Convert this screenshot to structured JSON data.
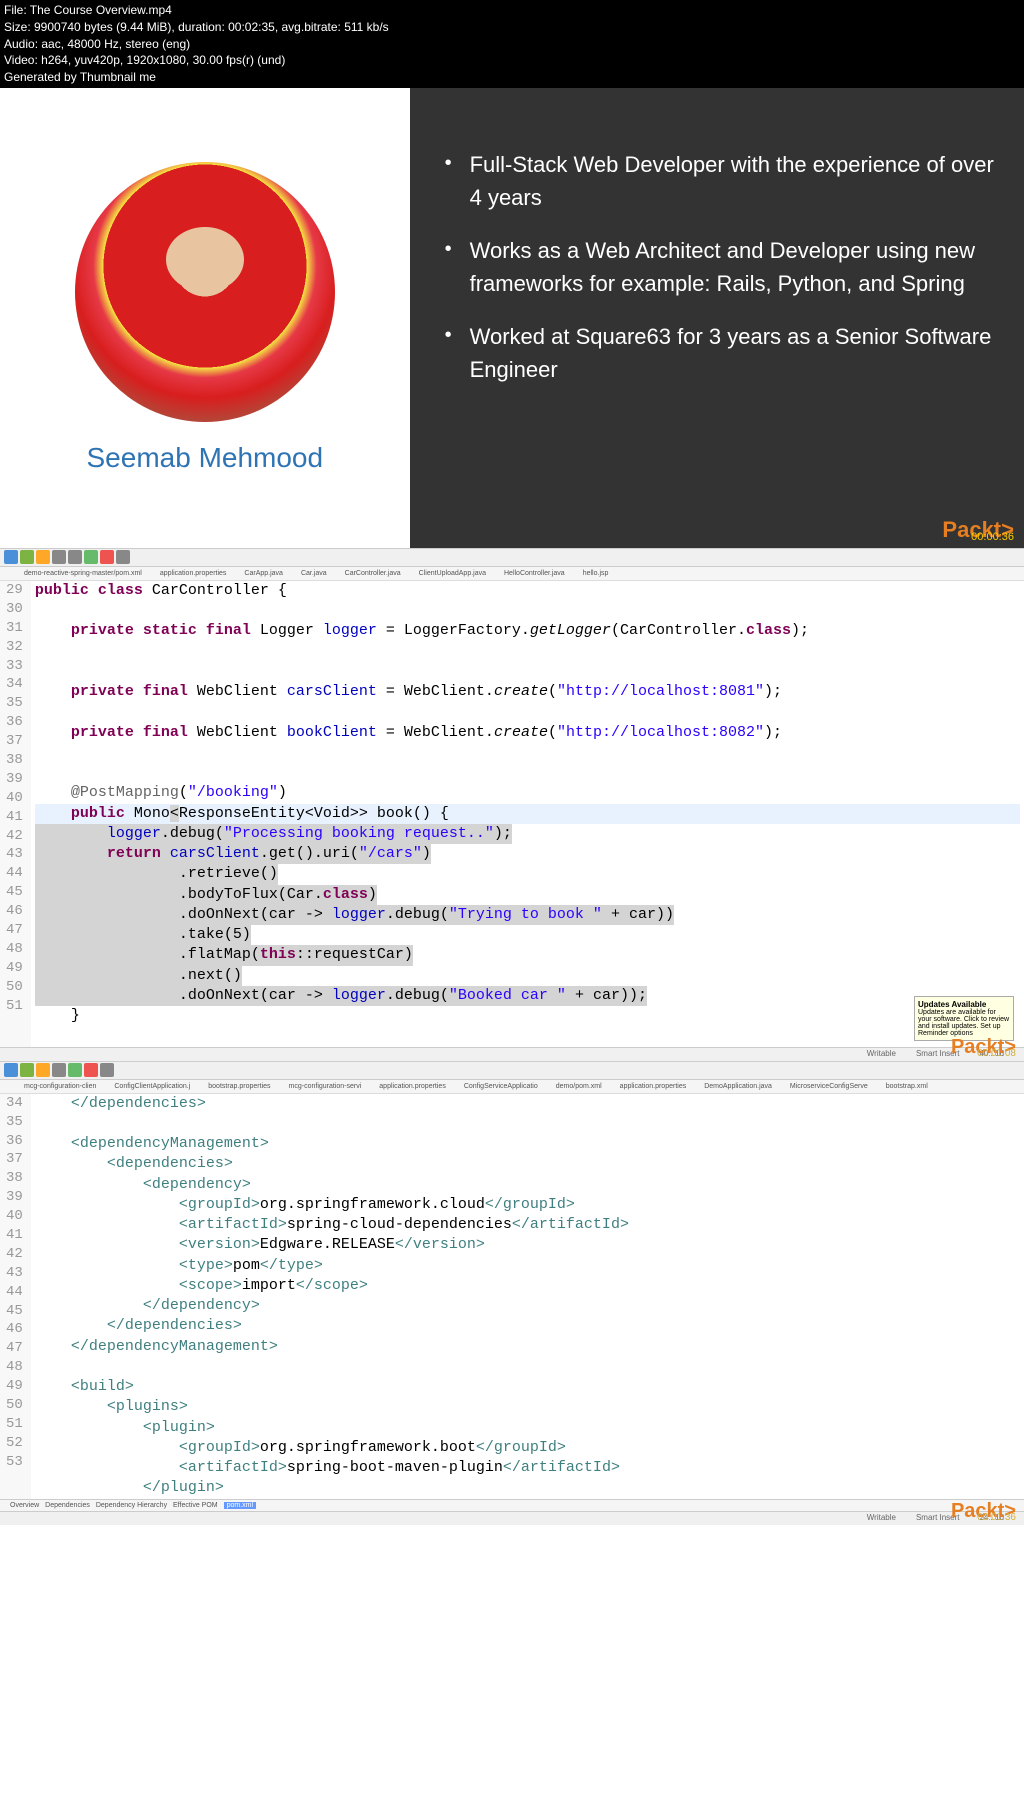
{
  "video_header": {
    "file": "File: The Course Overview.mp4",
    "size": "Size: 9900740 bytes (9.44 MiB), duration: 00:02:35, avg.bitrate: 511 kb/s",
    "audio": "Audio: aac, 48000 Hz, stereo (eng)",
    "video": "Video: h264, yuv420p, 1920x1080, 30.00 fps(r) (und)",
    "generated": "Generated by Thumbnail me"
  },
  "slide": {
    "presenter_name": "Seemab Mehmood",
    "bullets": [
      "Full-Stack Web Developer with the experience of over 4 years",
      "Works as a Web Architect and Developer using new frameworks for example: Rails, Python, and Spring",
      "Worked at Square63 for 3 years as a Senior Software Engineer"
    ],
    "brand": "Packt>",
    "timestamp": "00:00:36"
  },
  "ide1": {
    "tabs": [
      "demo-reactive-spring-master/pom.xml",
      "application.properties",
      "CarApp.java",
      "Car.java",
      "CarController.java",
      "ClientUploadApp.java",
      "HelloController.java",
      "hello.jsp"
    ],
    "lines": [
      {
        "n": 29,
        "html": "<span class='kw-purple'>public class</span> CarController {"
      },
      {
        "n": 30,
        "html": ""
      },
      {
        "n": 31,
        "html": "    <span class='kw-purple'>private static final</span> Logger <span class='kw-blue'>logger</span> = LoggerFactory.<span style='font-style:italic'>getLogger</span>(CarController.<span class='kw-purple'>class</span>);"
      },
      {
        "n": 32,
        "html": ""
      },
      {
        "n": 33,
        "html": ""
      },
      {
        "n": 34,
        "html": "    <span class='kw-purple'>private final</span> WebClient <span class='kw-blue'>carsClient</span> = WebClient.<span style='font-style:italic'>create</span>(<span class='str-blue'>\"http://localhost:8081\"</span>);"
      },
      {
        "n": 35,
        "html": ""
      },
      {
        "n": 36,
        "html": "    <span class='kw-purple'>private final</span> WebClient <span class='kw-blue'>bookClient</span> = WebClient.<span style='font-style:italic'>create</span>(<span class='str-blue'>\"http://localhost:8082\"</span>);"
      },
      {
        "n": 37,
        "html": ""
      },
      {
        "n": 38,
        "html": ""
      },
      {
        "n": 39,
        "html": "    <span class='anno'>@PostMapping</span>(<span class='str-blue'>\"/booking\"</span>)"
      },
      {
        "n": 40,
        "html": "    <span class='kw-purple'>public</span> Mono<span style='background:#d4d4d4'>&lt;</span>ResponseEntity&lt;Void&gt;&gt; book() {",
        "hl": true
      },
      {
        "n": 41,
        "html": "        <span class='kw-blue'>logger</span>.debug(<span class='str-blue'>\"Processing booking request..\"</span>);",
        "sel": true
      },
      {
        "n": 42,
        "html": "        <span class='kw-purple'>return</span> <span class='kw-blue'>carsClient</span>.get().uri(<span class='str-blue'>\"/cars\"</span>)",
        "sel": true
      },
      {
        "n": 43,
        "html": "                .retrieve()",
        "sel": true
      },
      {
        "n": 44,
        "html": "                .bodyToFlux(Car.<span class='kw-purple'>class</span>)",
        "sel": true
      },
      {
        "n": 45,
        "html": "                .doOnNext(car -&gt; <span class='kw-blue'>logger</span>.debug(<span class='str-blue'>\"Trying to book \"</span> + car))",
        "sel": true
      },
      {
        "n": 46,
        "html": "                .take(5)",
        "sel": true
      },
      {
        "n": 47,
        "html": "                .flatMap(<span class='kw-purple'>this</span>::requestCar)",
        "sel": true
      },
      {
        "n": 48,
        "html": "                .next()",
        "sel": true
      },
      {
        "n": 49,
        "html": "                .doOnNext(car -&gt; <span class='kw-blue'>logger</span>.debug(<span class='str-blue'>\"Booked car \"</span> + car));",
        "sel": true
      },
      {
        "n": 50,
        "html": "    }"
      },
      {
        "n": 51,
        "html": ""
      }
    ],
    "popup": {
      "title": "Updates Available",
      "body": "Updates are available for your software. Click to review and install updates. Set up Reminder options"
    },
    "status": {
      "writable": "Writable",
      "insert": "Smart Insert",
      "pos": "40 : 16"
    },
    "timestamp": "00:01:08"
  },
  "ide2": {
    "tabs": [
      "mcg-configuration-clien",
      "ConfigClientApplication.j",
      "bootstrap.properties",
      "mcg-configuration-servi",
      "application.properties",
      "ConfigServiceApplicatio",
      "demo/pom.xml",
      "application.properties",
      "DemoApplication.java",
      "MicroserviceConfigServe",
      "bootstrap.xml"
    ],
    "lines": [
      {
        "n": 34,
        "html": "    <span class='tag'>&lt;/dependencies&gt;</span>"
      },
      {
        "n": 35,
        "html": ""
      },
      {
        "n": 36,
        "html": "    <span class='tag'>&lt;dependencyManagement&gt;</span>"
      },
      {
        "n": 37,
        "html": "        <span class='tag'>&lt;dependencies&gt;</span>"
      },
      {
        "n": 38,
        "html": "            <span class='tag'>&lt;dependency&gt;</span>"
      },
      {
        "n": 39,
        "html": "                <span class='tag'>&lt;groupId&gt;</span>org.springframework.cloud<span class='tag'>&lt;/groupId&gt;</span>"
      },
      {
        "n": 40,
        "html": "                <span class='tag'>&lt;artifactId&gt;</span>spring-cloud-dependencies<span class='tag'>&lt;/artifactId&gt;</span>"
      },
      {
        "n": 41,
        "html": "                <span class='tag'>&lt;version&gt;</span>Edgware.RELEASE<span class='tag'>&lt;/version&gt;</span>"
      },
      {
        "n": 42,
        "html": "                <span class='tag'>&lt;type&gt;</span>pom<span class='tag'>&lt;/type&gt;</span>"
      },
      {
        "n": 43,
        "html": "                <span class='tag'>&lt;scope&gt;</span>import<span class='tag'>&lt;/scope&gt;</span>"
      },
      {
        "n": 44,
        "html": "            <span class='tag'>&lt;/dependency&gt;</span>"
      },
      {
        "n": 45,
        "html": "        <span class='tag'>&lt;/dependencies&gt;</span>"
      },
      {
        "n": 46,
        "html": "    <span class='tag'>&lt;/dependencyManagement&gt;</span>"
      },
      {
        "n": 47,
        "html": ""
      },
      {
        "n": 48,
        "html": "    <span class='tag'>&lt;build&gt;</span>"
      },
      {
        "n": 49,
        "html": "        <span class='tag'>&lt;plugins&gt;</span>"
      },
      {
        "n": 50,
        "html": "            <span class='tag'>&lt;plugin&gt;</span>"
      },
      {
        "n": 51,
        "html": "                <span class='tag'>&lt;groupId&gt;</span>org.springframework.boot<span class='tag'>&lt;/groupId&gt;</span>"
      },
      {
        "n": 52,
        "html": "                <span class='tag'>&lt;artifactId&gt;</span>spring-boot-maven-plugin<span class='tag'>&lt;/artifactId&gt;</span>"
      },
      {
        "n": 53,
        "html": "            <span class='tag'>&lt;/plugin&gt;</span>"
      }
    ],
    "bottom_tabs": [
      "Overview",
      "Dependencies",
      "Dependency Hierarchy",
      "Effective POM"
    ],
    "bottom_active": "pom.xml",
    "status": {
      "writable": "Writable",
      "insert": "Smart Insert",
      "pos": "24 : 10"
    },
    "timestamp": "00:01:36"
  }
}
